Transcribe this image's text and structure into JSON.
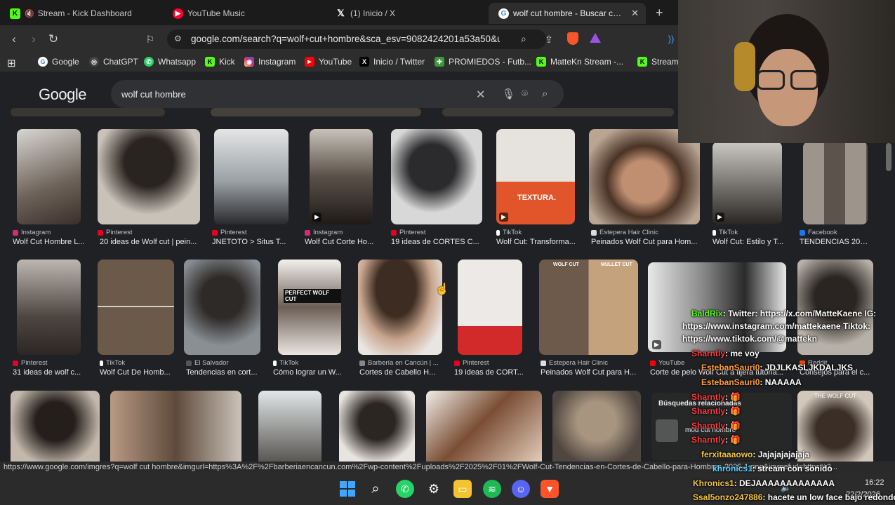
{
  "tabs": [
    {
      "title": "Stream - Kick Dashboard",
      "favicon": "kick-icon",
      "color": "#53fc18"
    },
    {
      "title": "YouTube Music",
      "favicon": "youtube-music-icon",
      "color": "#ff0033"
    },
    {
      "title": "(1) Inicio / X",
      "favicon": "x-icon",
      "color": "#000000"
    },
    {
      "title": "wolf cut hombre - Buscar con Go",
      "favicon": "google-icon",
      "color": "#ffffff"
    }
  ],
  "address_bar": {
    "url": "google.com/search?q=wolf+cut+hombre&sca_esv=9082424201a53a50&ud..."
  },
  "bookmarks": [
    {
      "label": "Google",
      "color": "#4285f4",
      "glyph": "G"
    },
    {
      "label": "ChatGPT",
      "color": "#666666",
      "glyph": "◎"
    },
    {
      "label": "Whatsapp",
      "color": "#25d366",
      "glyph": "✆"
    },
    {
      "label": "Kick",
      "color": "#53fc18",
      "glyph": "K"
    },
    {
      "label": "Instagram",
      "color": "#d62976",
      "glyph": "◉"
    },
    {
      "label": "YouTube",
      "color": "#ff0000",
      "glyph": "▶"
    },
    {
      "label": "Inicio / Twitter",
      "color": "#000000",
      "glyph": "X"
    },
    {
      "label": "PROMIEDOS - Futb...",
      "color": "#3a9a3a",
      "glyph": "✚"
    },
    {
      "label": "MatteKn Stream -...",
      "color": "#53fc18",
      "glyph": "K"
    },
    {
      "label": "Stream",
      "color": "#53fc18",
      "glyph": "K"
    }
  ],
  "google": {
    "logo": "Google",
    "query": "wolf cut hombre"
  },
  "row1": [
    {
      "source": "Instagram",
      "title": "Wolf Cut Hombre L...",
      "src_color": "#d62976"
    },
    {
      "source": "Pinterest",
      "title": "20 ideas de Wolf cut | pein...",
      "src_color": "#e60023"
    },
    {
      "source": "Pinterest",
      "title": "JNETOTO > Situs T...",
      "src_color": "#e60023"
    },
    {
      "source": "Instagram",
      "title": "Wolf Cut Corte Ho...",
      "src_color": "#d62976"
    },
    {
      "source": "Pinterest",
      "title": "19 ideas de CORTES C...",
      "src_color": "#e60023"
    },
    {
      "source": "TikTok",
      "title": "Wolf Cut: Transforma...",
      "src_color": "#111111"
    },
    {
      "source": "Estepera Hair Clinic",
      "title": "Peinados Wolf Cut para Hom...",
      "src_color": "#dddddd"
    },
    {
      "source": "TikTok",
      "title": "Wolf Cut: Estilo y T...",
      "src_color": "#111111"
    },
    {
      "source": "Facebook",
      "title": "TENDENCIAS 202...",
      "src_color": "#1877f2"
    }
  ],
  "row2": [
    {
      "source": "Pinterest",
      "title": "31 ideas de wolf c...",
      "src_color": "#e60023"
    },
    {
      "source": "TikTok",
      "title": "Wolf Cut De Homb...",
      "src_color": "#111111"
    },
    {
      "source": "El Salvador",
      "title": "Tendencias en cort...",
      "src_color": "#555555"
    },
    {
      "source": "TikTok",
      "title": "Cómo lograr un W...",
      "src_color": "#111111"
    },
    {
      "source": "Barbería en Cancún | ...",
      "title": "Cortes de Cabello H...",
      "src_color": "#888888"
    },
    {
      "source": "Pinterest",
      "title": "19 ideas de CORT...",
      "src_color": "#e60023"
    },
    {
      "source": "Estepera Hair Clinic",
      "title": "Peinados Wolf Cut para H...",
      "src_color": "#dddddd"
    },
    {
      "source": "YouTube",
      "title": "Corte de pelo Wolf Cut a tijera tutoria...",
      "src_color": "#ff0000"
    },
    {
      "source": "Reddit",
      "title": "Consejos para el c...",
      "src_color": "#ff4500"
    }
  ],
  "image_labels": {
    "textura": "TEXTURA.",
    "wolf_cut_small": "WOLF CUT",
    "mullet_cut": "MULLET CUT",
    "the_wolf_cut": "THE WOLF CUT",
    "perfect_wolf": "PERFECT WOLF CUT"
  },
  "related": {
    "title": "Búsquedas relacionadas",
    "item": "mod cut hombre"
  },
  "status_link": "https://www.google.com/imgres?q=wolf cut hombre&imgurl=https%3A%2F%2Fbarberiaencancun.com%2Fwp-content%2Fuploads%2F2025%2F01%2FWolf-Cut-Tendencias-en-Cortes-de-Cabello-para-Hombres-2025-1.png&imgrefurl=https%3...",
  "chat": [
    {
      "user": "BaldRix",
      "text": ": Twitter: https://x.com/MatteKaene IG:"
    },
    {
      "user": "",
      "text": "https://www.instagram.com/mattekaene Tiktok:"
    },
    {
      "user": "",
      "text": "https://www.tiktok.com/@mattekn"
    },
    {
      "user": "Sharntly",
      "text": ": me voy"
    },
    {
      "user": "EstebanSauri0",
      "text": ": JDJLKASLJKDALJKS"
    },
    {
      "user": "EstebanSauri0",
      "text": ": NAAAAA"
    },
    {
      "user": "Sharntly",
      "text": ": 🎁"
    },
    {
      "user": "Sharntly",
      "text": ": 🎁"
    },
    {
      "user": "Sharntly",
      "text": ": 🎁"
    },
    {
      "user": "Sharntly",
      "text": ": 🎁"
    },
    {
      "user": "ferxitaaaowo",
      "text": ": Jajajajajajaja"
    },
    {
      "user": "khronics1",
      "text": ": stream con sonido"
    },
    {
      "user": "Khronics1",
      "text": ": DEJAAAAAAAAAAAAA"
    },
    {
      "user": "Ssal5onzo247886",
      "text": ": hacete un low face bajo redondo"
    }
  ],
  "clock": {
    "time": "16:22",
    "date": "22/2/2026"
  }
}
